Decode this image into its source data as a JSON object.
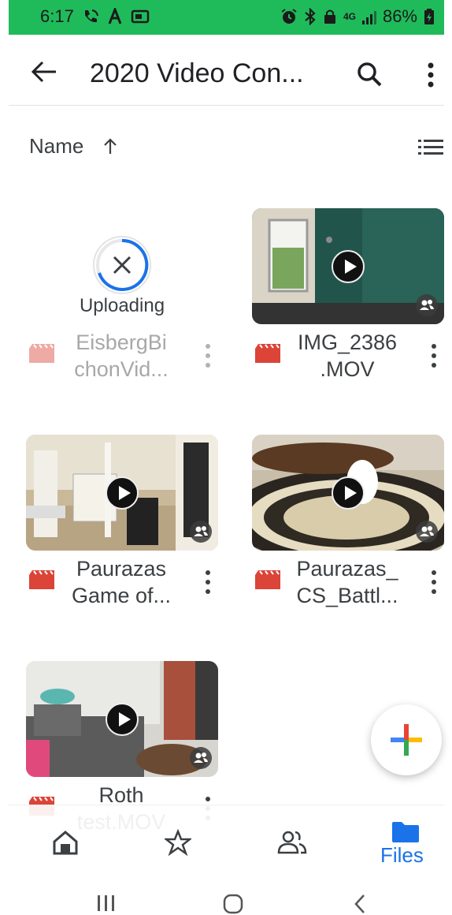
{
  "status_bar": {
    "time": "6:17",
    "battery": "86%",
    "network": "4G",
    "icons": [
      "phone-wifi-icon",
      "a-icon",
      "screen-icon",
      "alarm-icon",
      "bluetooth-icon",
      "lock-icon",
      "lte-icon",
      "signal-icon",
      "battery-charging-icon"
    ]
  },
  "app_bar": {
    "title": "2020 Video Con...",
    "back_icon": "arrow-back-icon",
    "search_icon": "search-icon",
    "more_icon": "more-vert-icon"
  },
  "sort": {
    "label": "Name",
    "direction_icon": "arrow-up-icon",
    "view_toggle_icon": "list-view-icon"
  },
  "files": [
    {
      "name": "EisbergBi\nchonVid...",
      "status": "Uploading",
      "uploading": true
    },
    {
      "name": "IMG_2386\n.MOV",
      "shared": true
    },
    {
      "name": "Paurazas\nGame of...",
      "shared": true
    },
    {
      "name": "Paurazas_\nCS_Battl...",
      "shared": true
    },
    {
      "name": "Roth\ntest.MOV",
      "shared": true
    }
  ],
  "fab": {
    "icon": "plus-multicolor-icon"
  },
  "bottom_nav": {
    "items": [
      {
        "icon": "home-icon",
        "label": ""
      },
      {
        "icon": "star-icon",
        "label": ""
      },
      {
        "icon": "shared-people-icon",
        "label": ""
      },
      {
        "icon": "folder-icon",
        "label": "Files",
        "active": true
      }
    ],
    "active_color": "#1a73e8"
  },
  "system_nav": {
    "icons": [
      "recents-icon",
      "home-circle-icon",
      "back-chevron-icon"
    ]
  },
  "colors": {
    "status_bar": "#1fbb5a",
    "video_icon": "#db4437",
    "accent": "#1a73e8"
  }
}
